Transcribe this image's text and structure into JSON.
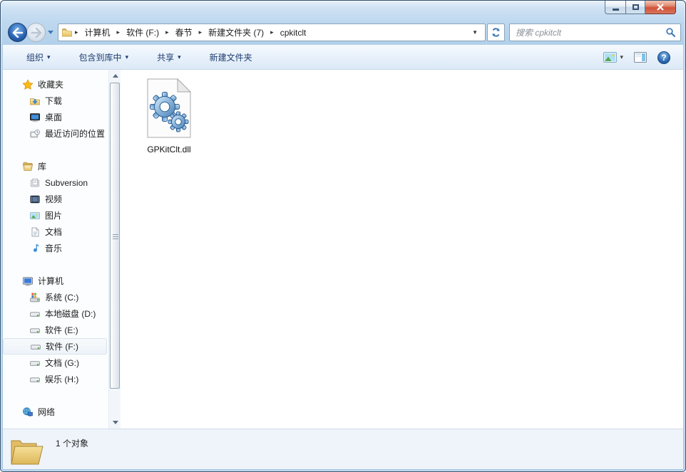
{
  "breadcrumb": {
    "items": [
      "计算机",
      "软件 (F:)",
      "春节",
      "新建文件夹 (7)",
      "cpkitclt"
    ]
  },
  "search": {
    "placeholder": "搜索 cpkitclt"
  },
  "toolbar": {
    "organize": "组织",
    "include_in_library": "包含到库中",
    "share": "共享",
    "new_folder": "新建文件夹"
  },
  "sidebar": {
    "favorites": {
      "label": "收藏夹",
      "items": [
        "下载",
        "桌面",
        "最近访问的位置"
      ]
    },
    "libraries": {
      "label": "库",
      "items": [
        "Subversion",
        "视频",
        "图片",
        "文档",
        "音乐"
      ]
    },
    "computer": {
      "label": "计算机",
      "items": [
        "系统 (C:)",
        "本地磁盘 (D:)",
        "软件 (E:)",
        "软件 (F:)",
        "文档 (G:)",
        "娱乐 (H:)"
      ],
      "selected": "软件 (F:)"
    },
    "network": {
      "label": "网络"
    }
  },
  "files": [
    {
      "name": "GPKitClt.dll",
      "icon": "dll-file-icon"
    }
  ],
  "statusbar": {
    "count": "1 个对象"
  },
  "icons": {
    "caret_down": "▾",
    "address_caret": "▼",
    "breadcrumb_separator": "▸",
    "help_glyph": "?"
  },
  "colors": {
    "chrome_top": "#d5e6f5",
    "chrome_bottom": "#a9cae7",
    "toolbar_text": "#1e3c6e",
    "close_button": "#cf523a",
    "selection_border": "#d8e2ec",
    "accent_blue": "#3a76b5"
  }
}
